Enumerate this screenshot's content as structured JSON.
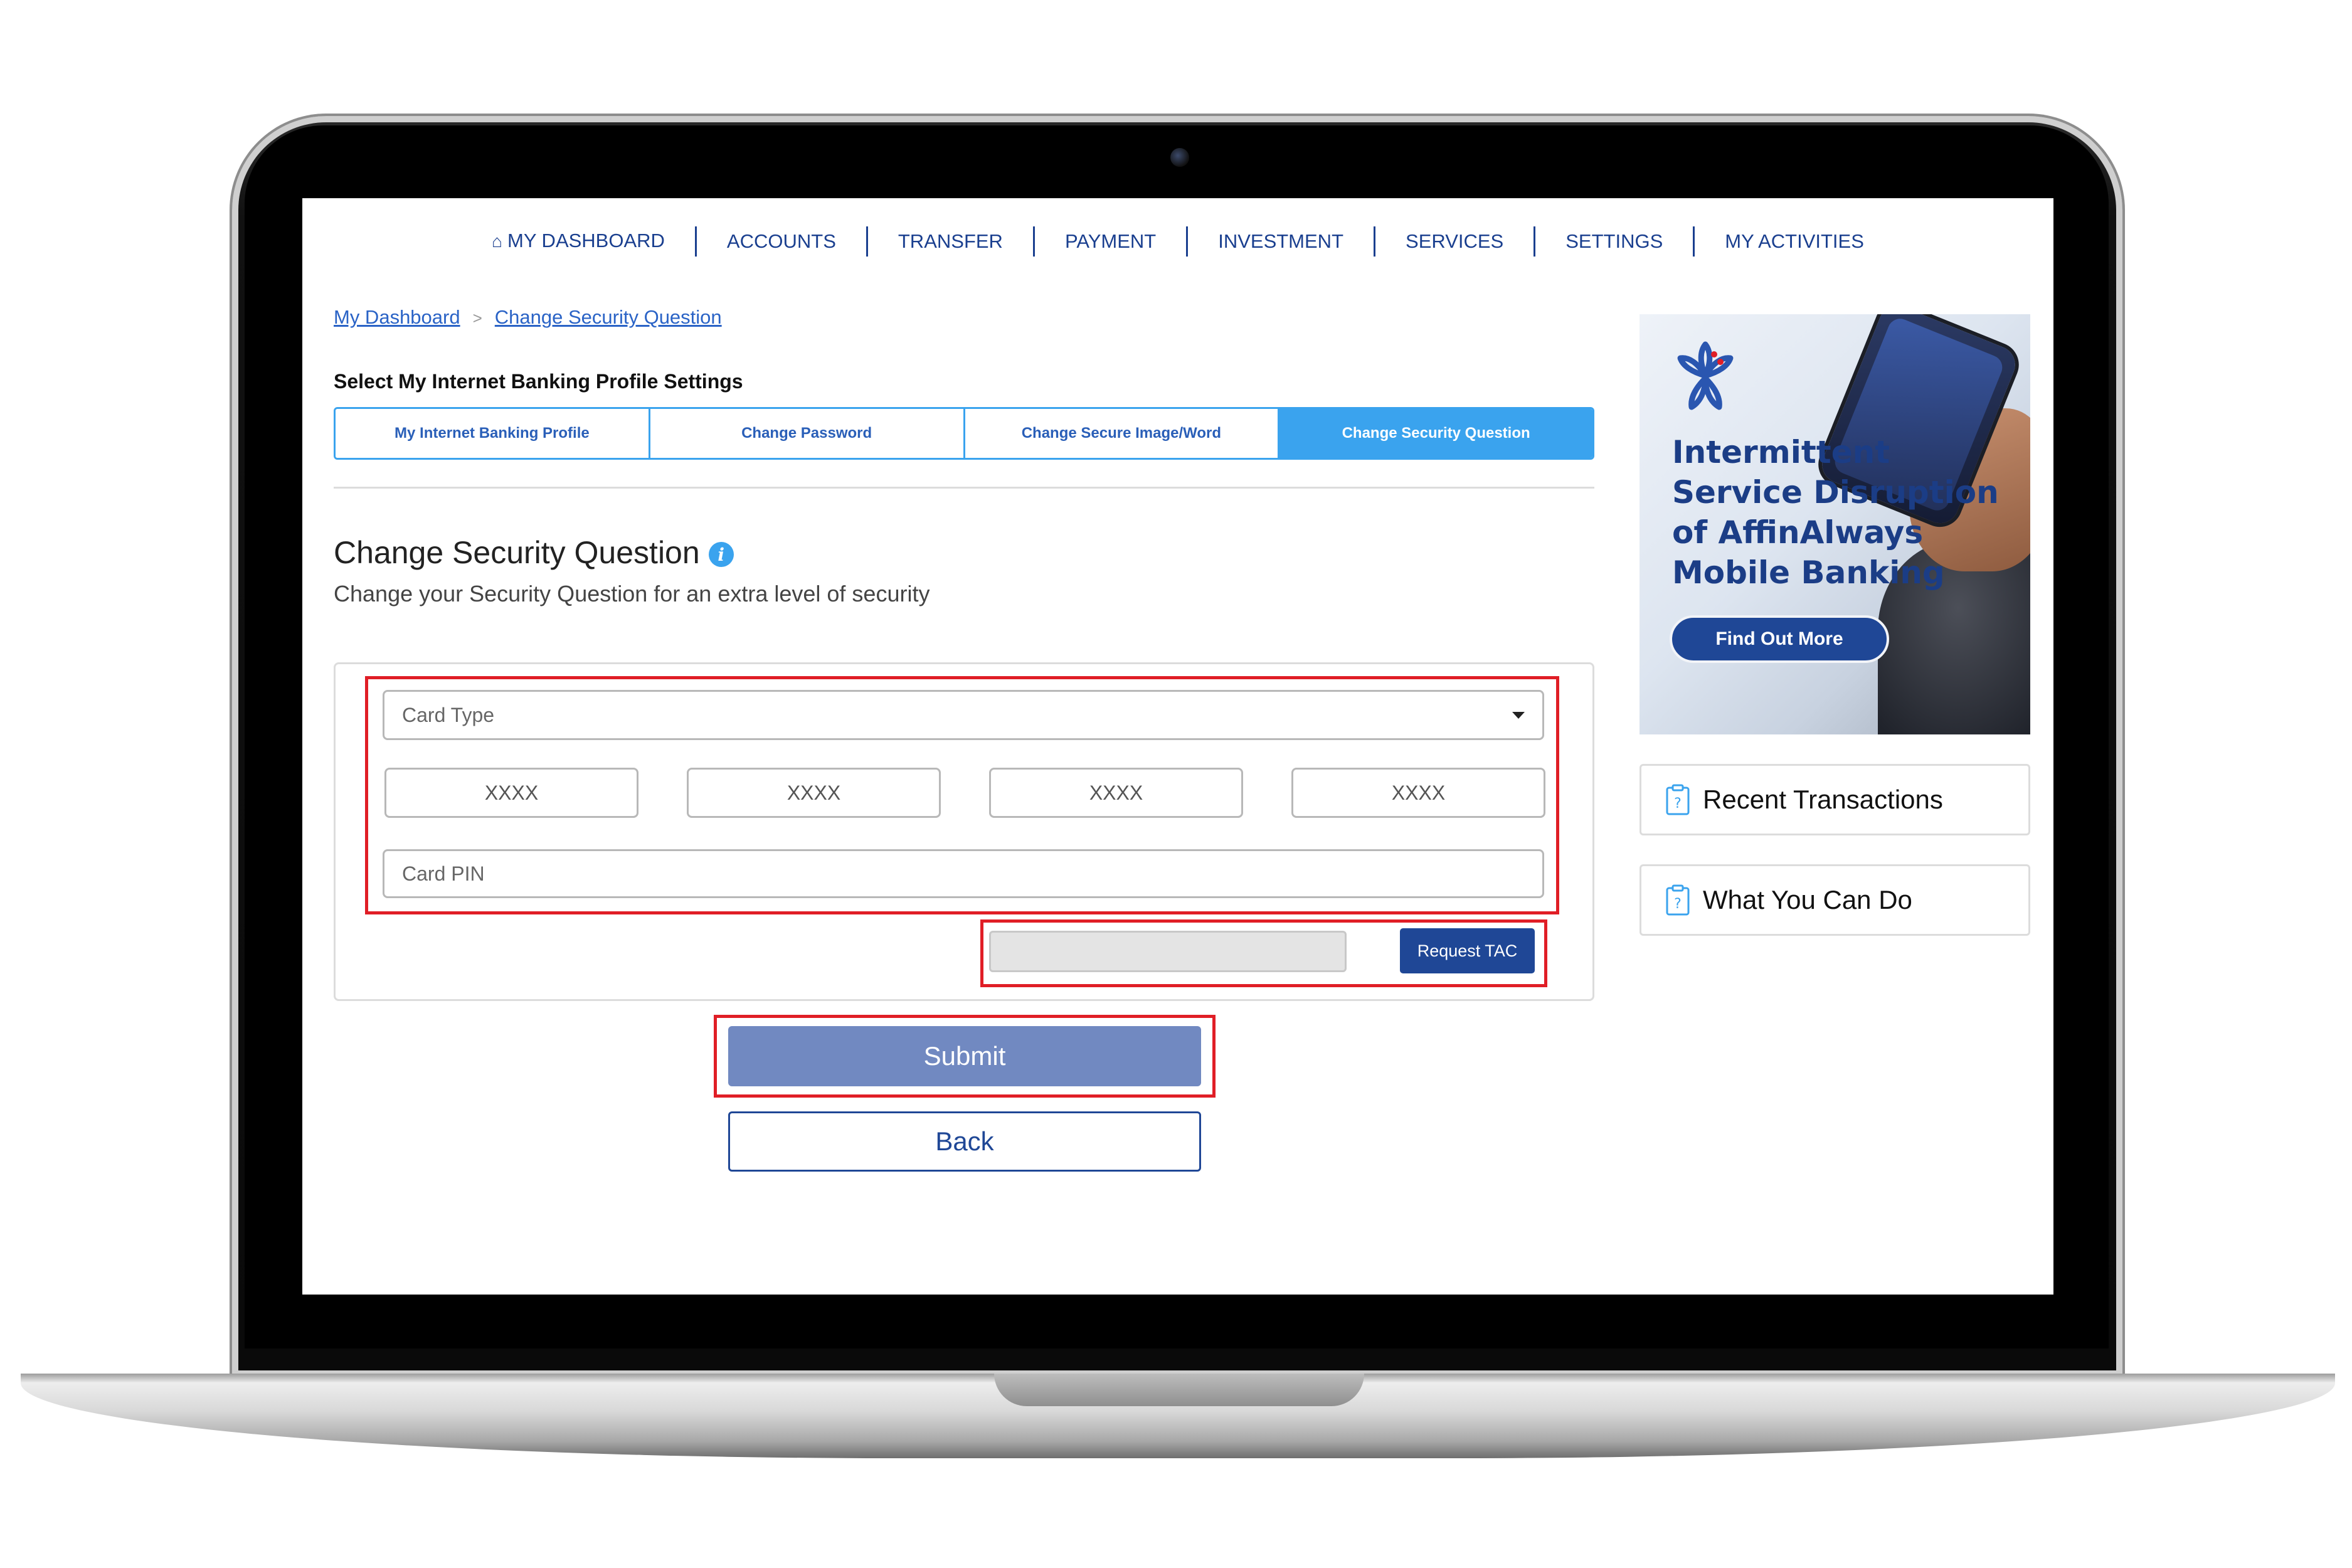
{
  "nav": {
    "items": [
      "MY DASHBOARD",
      "ACCOUNTS",
      "TRANSFER",
      "PAYMENT",
      "INVESTMENT",
      "SERVICES",
      "SETTINGS",
      "MY ACTIVITIES"
    ],
    "home_icon": "home-icon"
  },
  "breadcrumb": {
    "items": [
      "My Dashboard",
      "Change Security Question"
    ],
    "separator": ">"
  },
  "settings": {
    "label": "Select My Internet Banking Profile Settings",
    "tabs": [
      "My Internet Banking Profile",
      "Change Password",
      "Change Secure Image/Word",
      "Change Security Question"
    ],
    "active_tab": 3
  },
  "page": {
    "title": "Change Security Question",
    "subtitle": "Change your Security Question for an extra level of security",
    "info_icon": "info-icon"
  },
  "form": {
    "card_type_placeholder": "Card Type",
    "card_number_placeholders": [
      "XXXX",
      "XXXX",
      "XXXX",
      "XXXX"
    ],
    "card_pin_placeholder": "Card PIN",
    "tac_value": "",
    "request_tac_label": "Request TAC",
    "submit_label": "Submit",
    "back_label": "Back"
  },
  "banner": {
    "line1": "Intermittent",
    "line2": "Service Disruption",
    "line3": "of AffinAlways",
    "line4": "Mobile Banking",
    "button_label": "Find Out More"
  },
  "sidebar": {
    "recent_transactions": "Recent Transactions",
    "what_you_can_do": "What You Can Do"
  },
  "colors": {
    "nav_text": "#1a3f8f",
    "tab_active": "#3aa3ee",
    "primary_button": "#1f4796",
    "submit_button": "#7189c1",
    "highlight_red": "#e01e26"
  }
}
